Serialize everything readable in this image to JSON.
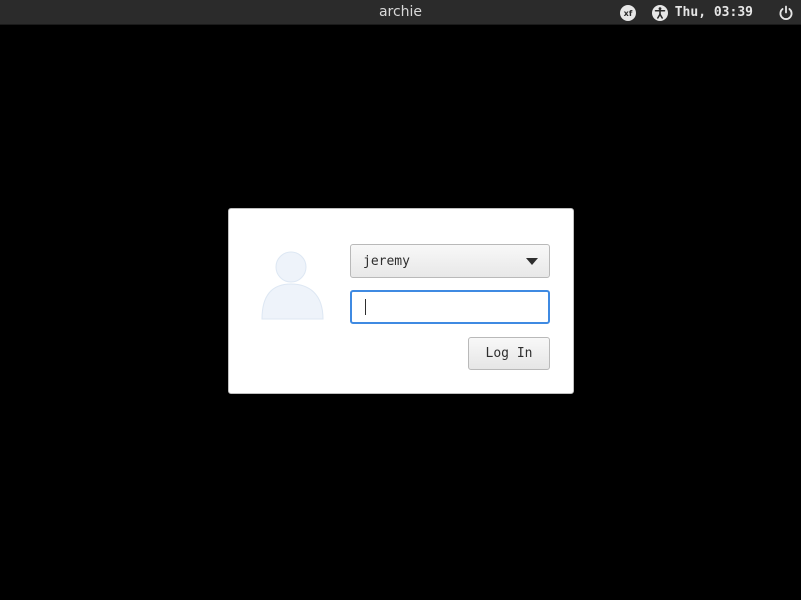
{
  "top_panel": {
    "hostname": "archie",
    "clock": "Thu, 03:39",
    "indicators": [
      {
        "icon": "keyboard-layout-icon",
        "text": "xf"
      },
      {
        "icon": "accessibility-icon"
      },
      {
        "icon": "power-icon"
      }
    ]
  },
  "login": {
    "avatar_icon": "user-avatar-icon",
    "selected_user": "jeremy",
    "password_value": "",
    "login_label": "Log In"
  },
  "colors": {
    "desktop_background": "#000000",
    "panel_background": "#2b2b2b",
    "focus_accent": "#3f8ae2"
  }
}
